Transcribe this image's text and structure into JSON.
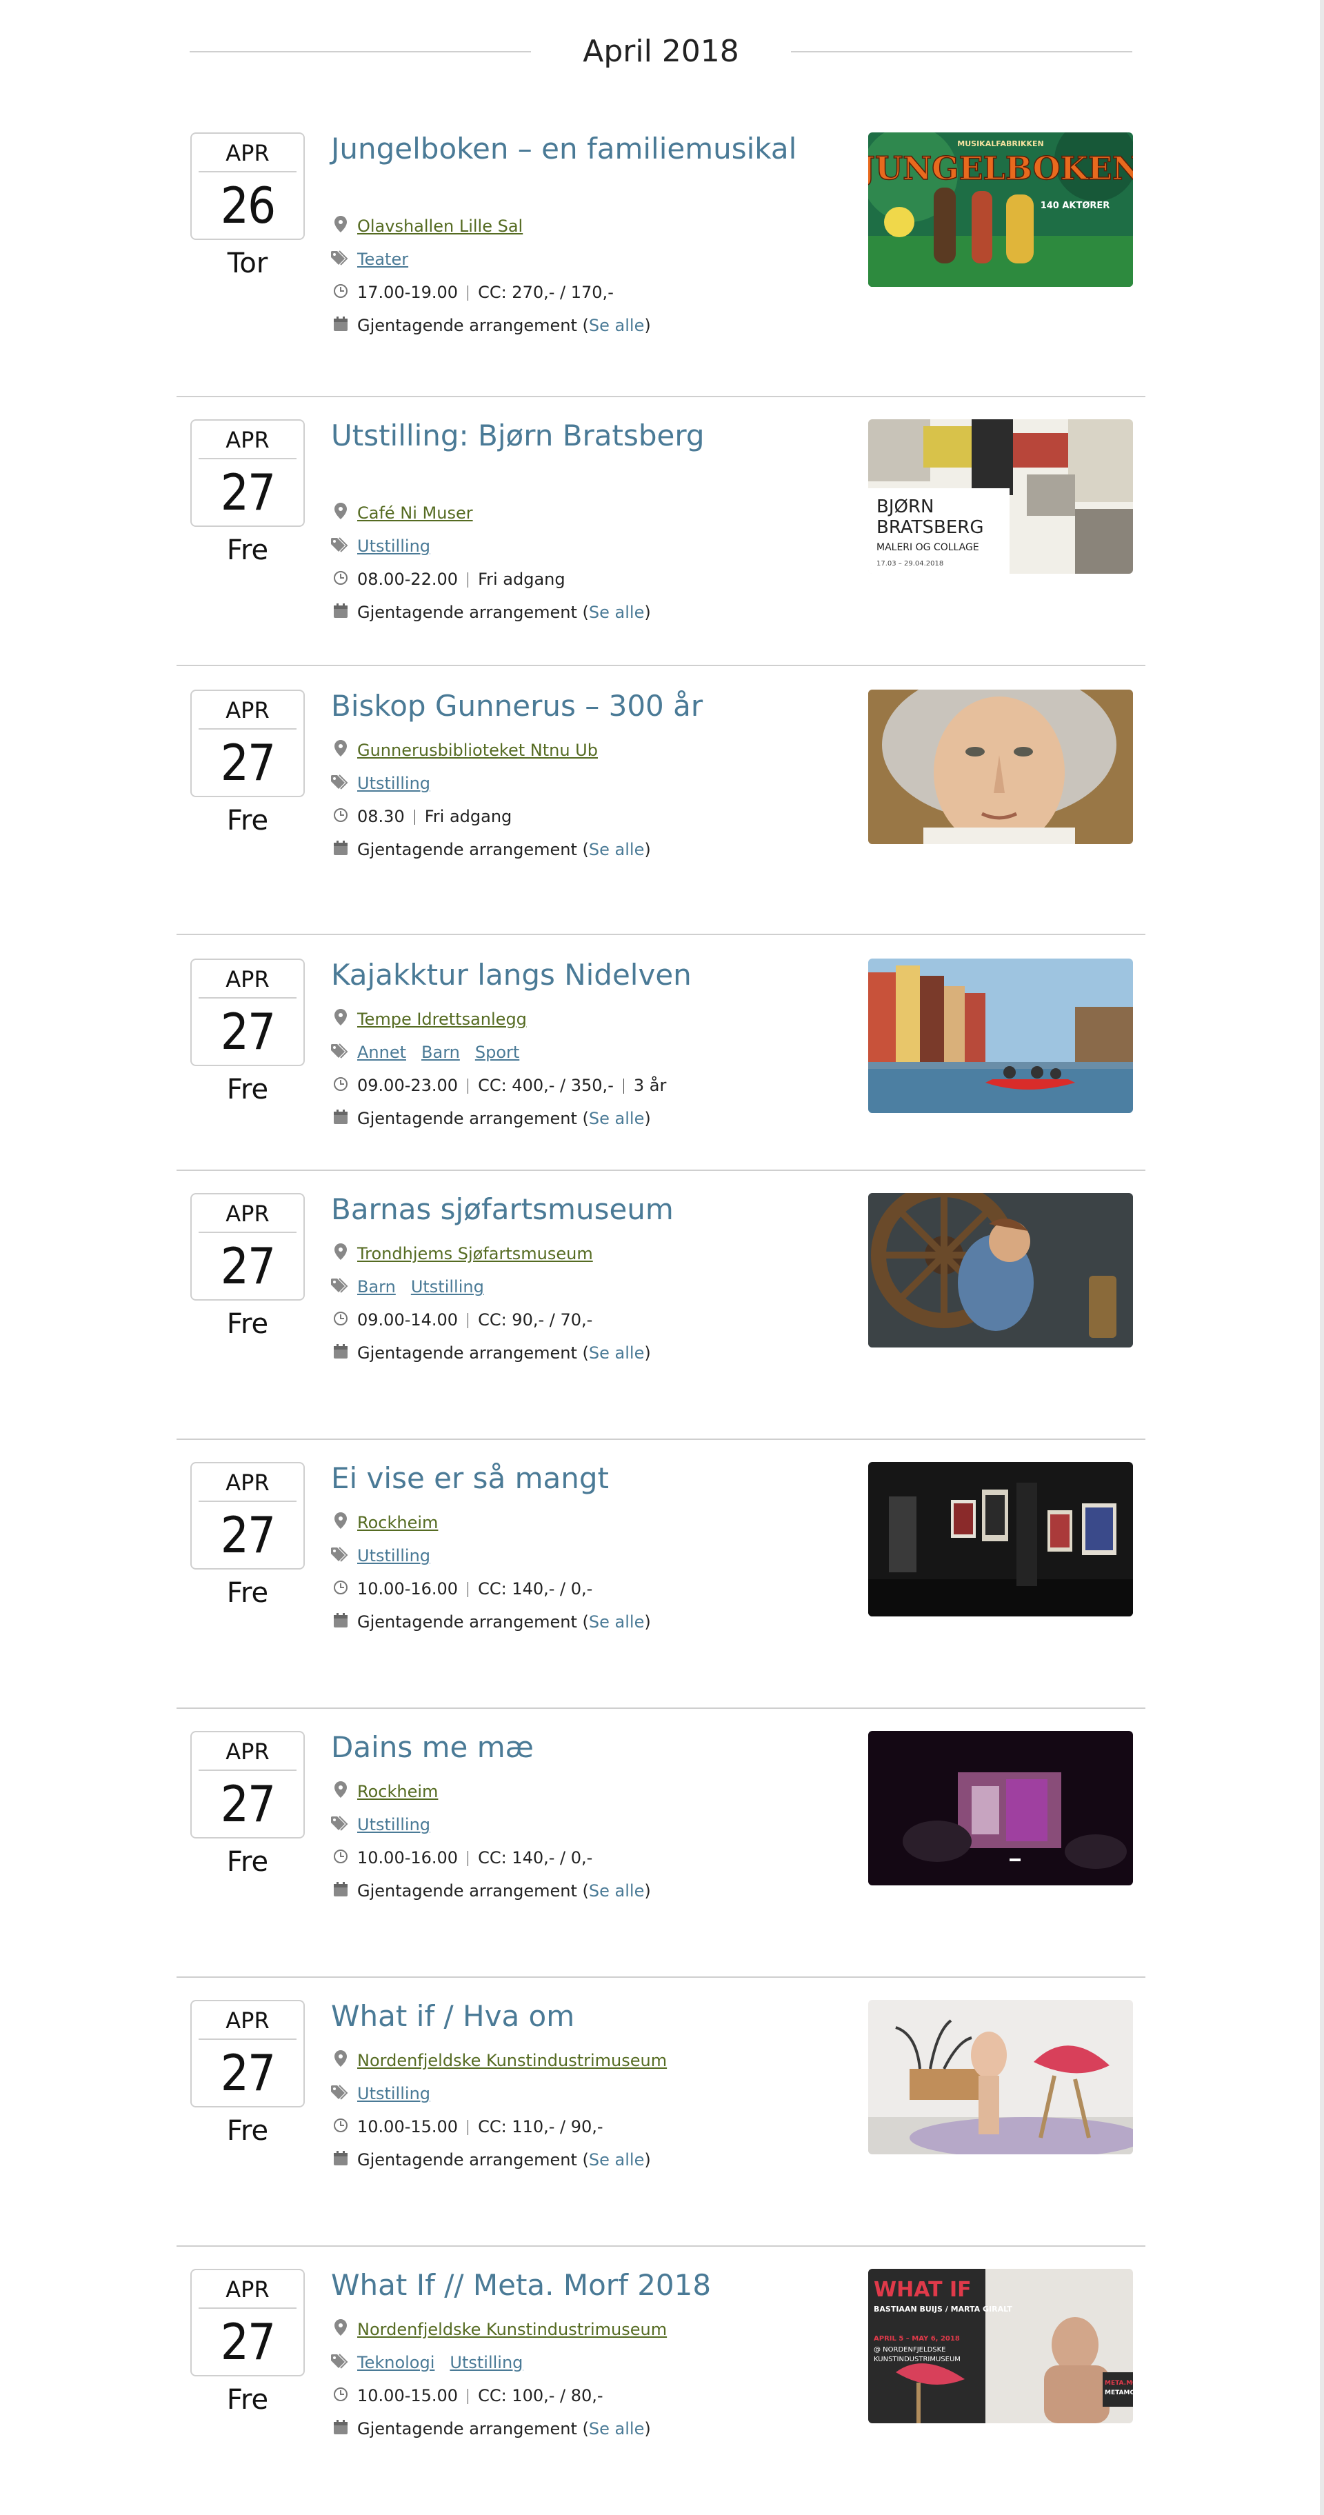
{
  "month_header": "April 2018",
  "labels": {
    "recurring": "Gjentagende arrangement",
    "see_all": "Se alle",
    "open_paren": "(",
    "close_paren": ")"
  },
  "events": [
    {
      "month": "APR",
      "day": "26",
      "weekday": "Tor",
      "title": "Jungelboken – en familiemusikal",
      "location": "Olavshallen Lille Sal",
      "tags": [
        "Teater"
      ],
      "time": "17.00-19.00",
      "price": "CC: 270,- / 170,-",
      "extra": "",
      "image": "jungelboken-poster",
      "image_text": [
        "MUSIKALFABRIKKEN",
        "JUNGELBOKEN",
        "140 AKTØRER"
      ]
    },
    {
      "month": "APR",
      "day": "27",
      "weekday": "Fre",
      "title": "Utstilling: Bjørn Bratsberg",
      "location": "Café Ni Muser",
      "tags": [
        "Utstilling"
      ],
      "time": "08.00-22.00",
      "price": "Fri adgang",
      "extra": "",
      "image": "bratsberg-poster",
      "image_text": [
        "BJØRN",
        "BRATSBERG",
        "MALERI OG COLLAGE",
        "17.03 – 29.04.2018"
      ]
    },
    {
      "month": "APR",
      "day": "27",
      "weekday": "Fre",
      "title": "Biskop Gunnerus – 300 år",
      "location": "Gunnerusbiblioteket Ntnu Ub",
      "tags": [
        "Utstilling"
      ],
      "time": "08.30",
      "price": "Fri adgang",
      "extra": "",
      "image": "gunnerus-portrait",
      "image_text": []
    },
    {
      "month": "APR",
      "day": "27",
      "weekday": "Fre",
      "title": "Kajakktur langs Nidelven",
      "location": "Tempe Idrettsanlegg",
      "tags": [
        "Annet",
        "Barn",
        "Sport"
      ],
      "time": "09.00-23.00",
      "price": "CC: 400,- / 350,-",
      "extra": "3 år",
      "image": "kayak-river-photo",
      "image_text": []
    },
    {
      "month": "APR",
      "day": "27",
      "weekday": "Fre",
      "title": "Barnas sjøfartsmuseum",
      "location": "Trondhjems Sjøfartsmuseum",
      "tags": [
        "Barn",
        "Utstilling"
      ],
      "time": "09.00-14.00",
      "price": "CC: 90,- / 70,-",
      "extra": "",
      "image": "ship-wheel-photo",
      "image_text": []
    },
    {
      "month": "APR",
      "day": "27",
      "weekday": "Fre",
      "title": "Ei vise er så mangt",
      "location": "Rockheim",
      "tags": [
        "Utstilling"
      ],
      "time": "10.00-16.00",
      "price": "CC: 140,- / 0,-",
      "extra": "",
      "image": "gallery-posters-photo",
      "image_text": []
    },
    {
      "month": "APR",
      "day": "27",
      "weekday": "Fre",
      "title": "Dains me mæ",
      "location": "Rockheim",
      "tags": [
        "Utstilling"
      ],
      "time": "10.00-16.00",
      "price": "CC: 140,- / 0,-",
      "extra": "",
      "image": "screen-projection-photo",
      "image_text": []
    },
    {
      "month": "APR",
      "day": "27",
      "weekday": "Fre",
      "title": "What if / Hva om",
      "location": "Nordenfjeldske Kunstindustrimuseum",
      "tags": [
        "Utstilling"
      ],
      "time": "10.00-15.00",
      "price": "CC: 110,- / 90,-",
      "extra": "",
      "image": "interior-lips-photo",
      "image_text": []
    },
    {
      "month": "APR",
      "day": "27",
      "weekday": "Fre",
      "title": "What If // Meta. Morf 2018",
      "location": "Nordenfjeldske Kunstindustrimuseum",
      "tags": [
        "Teknologi",
        "Utstilling"
      ],
      "time": "10.00-15.00",
      "price": "CC: 100,- / 80,-",
      "extra": "",
      "image": "whatif-poster",
      "image_text": [
        "WHAT IF",
        "BASTIAAN BUIJS / MARTA GIRALT",
        "APRIL 5 – MAY 6, 2018",
        "@ NORDENFJELDSKE",
        "KUNSTINDUSTRIMUSEUM",
        "META.MOR",
        "METAMOR"
      ]
    }
  ],
  "colors": {
    "title": "#4a7a96",
    "location_link": "#556b22",
    "divider": "#cfcfcf",
    "icon": "#777777"
  }
}
